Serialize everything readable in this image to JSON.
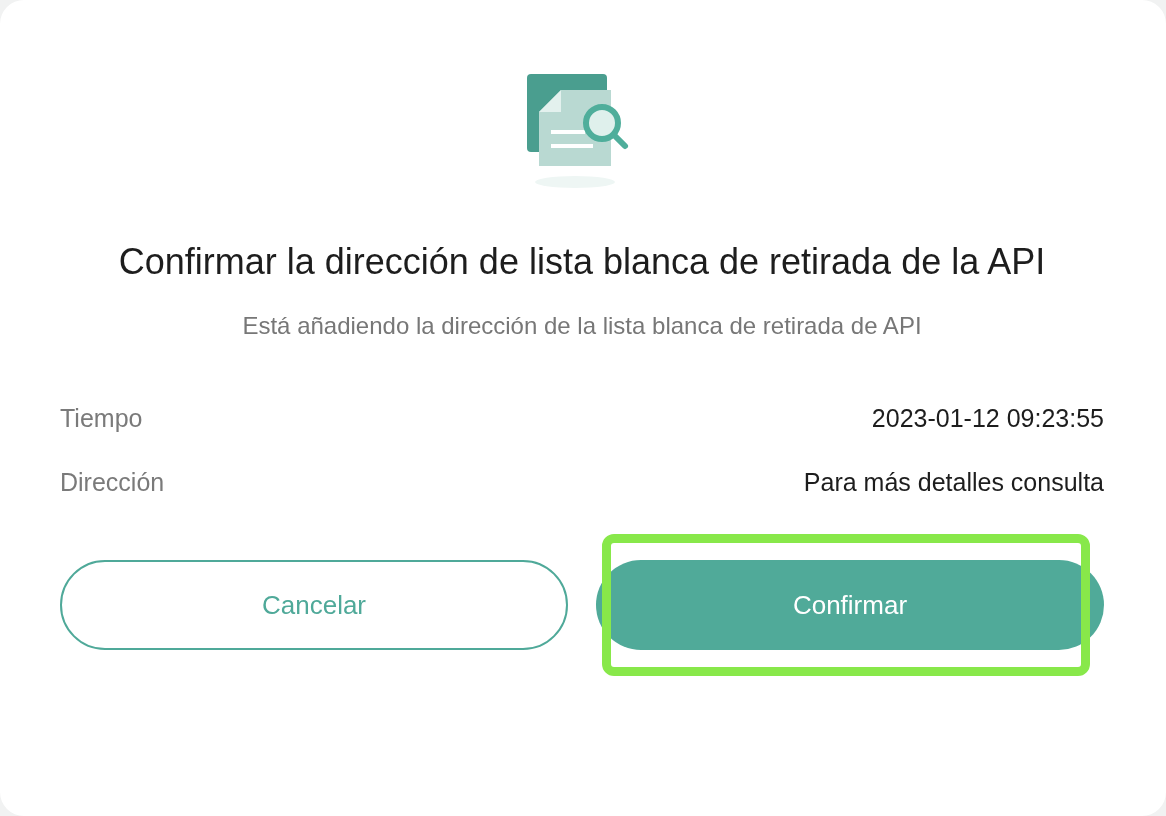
{
  "dialog": {
    "title": "Confirmar la dirección de lista blanca de retirada de la API",
    "subtitle": "Está añadiendo la dirección de la lista blanca de retirada de API",
    "details": [
      {
        "label": "Tiempo",
        "value": "2023-01-12 09:23:55"
      },
      {
        "label": "Dirección",
        "value": "Para más detalles consulta"
      }
    ],
    "buttons": [
      {
        "label": "Cancelar",
        "kind": "secondary",
        "highlighted": false
      },
      {
        "label": "Confirmar",
        "kind": "primary",
        "highlighted": true
      }
    ]
  }
}
